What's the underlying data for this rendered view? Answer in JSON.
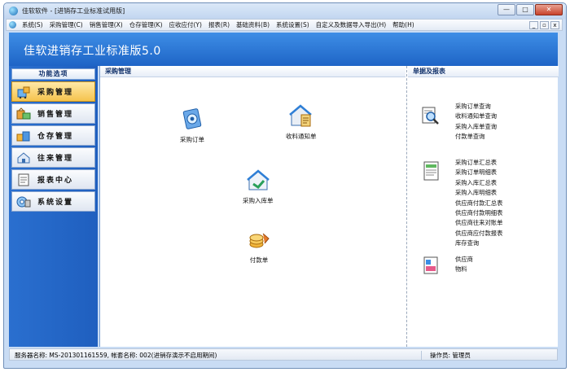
{
  "window": {
    "title": "佳软软件 - [进销存工业标准试用版]",
    "app_name": "佳软进销存工业标准版5.0"
  },
  "window_controls": {
    "minimize": "—",
    "maximize": "□",
    "close": "✕"
  },
  "mdi_controls": {
    "minimize": "_",
    "restore": "▫",
    "close": "x"
  },
  "menu": [
    "系统(S)",
    "采购管理(C)",
    "销售管理(X)",
    "仓存管理(K)",
    "应收应付(Y)",
    "报表(R)",
    "基础资料(B)",
    "系统设置(S)",
    "自定义及数据导入导出(H)",
    "帮助(H)"
  ],
  "sidebar": {
    "header": "功能选项",
    "items": [
      {
        "label": "采购管理",
        "icon": "purchase-icon",
        "active": true
      },
      {
        "label": "销售管理",
        "icon": "sales-icon",
        "active": false
      },
      {
        "label": "仓存管理",
        "icon": "warehouse-icon",
        "active": false
      },
      {
        "label": "往来管理",
        "icon": "accounts-icon",
        "active": false
      },
      {
        "label": "报表中心",
        "icon": "report-center-icon",
        "active": false
      },
      {
        "label": "系统设置",
        "icon": "system-settings-icon",
        "active": false
      }
    ]
  },
  "main": {
    "left_title": "采购管理",
    "right_title": "单据及报表",
    "functions": [
      {
        "label": "采购订单",
        "icon": "purchase-order-icon"
      },
      {
        "label": "收料通知单",
        "icon": "receipt-notice-icon"
      },
      {
        "label": "采购入库单",
        "icon": "purchase-inbound-icon"
      },
      {
        "label": "付款单",
        "icon": "payment-icon"
      }
    ],
    "report_groups": [
      {
        "icon": "query-icon",
        "items": [
          "采购订单查询",
          "收料通知单查询",
          "采购入库单查询",
          "付款单查询"
        ]
      },
      {
        "icon": "summary-report-icon",
        "items": [
          "采购订单汇总表",
          "采购订单明细表",
          "采购入库汇总表",
          "采购入库明细表",
          "供应商付款汇总表",
          "供应商付款明细表",
          "供应商往来对账单",
          "供应商应付款报表",
          "库存查询"
        ]
      },
      {
        "icon": "master-data-icon",
        "items": [
          "供应商",
          "物料"
        ]
      }
    ]
  },
  "status": {
    "left": "服务器名称: MS-20130116155​9, 帐套名称: 002(进销存演示不启用期间)",
    "right": "操作员: 管理员"
  },
  "colors": {
    "banner": "#2b78d8",
    "sidebar": "#2368c8",
    "active_item": "#f7c95a"
  }
}
